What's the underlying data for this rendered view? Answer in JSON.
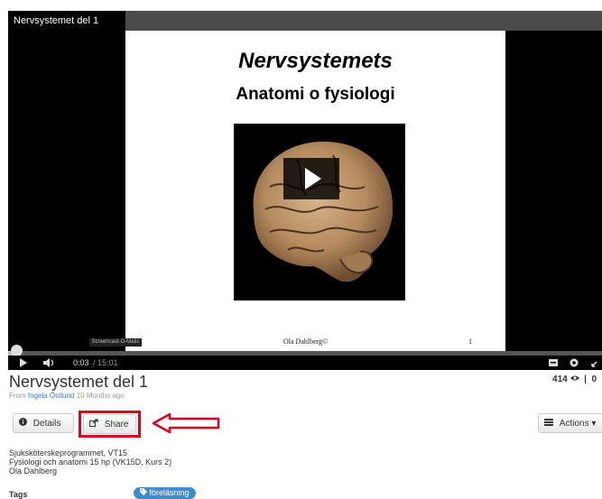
{
  "player": {
    "title": "Nervsystemet del 1",
    "slide_title": "Nervsystemets",
    "slide_subtitle": "Anatomi o fysiologi",
    "slide_author": "Ola Dahlberg©",
    "slide_page": "1",
    "watermark": "Screencast-O-Matic",
    "current_time": "0:03",
    "duration": "/ 15:01",
    "progress_fraction": 0.01
  },
  "video": {
    "title": "Nervsystemet del 1",
    "views": "414",
    "likes": "0",
    "from_label": "From",
    "author": "Ingela Östlund",
    "age": "10 Months ago"
  },
  "buttons": {
    "details": "Details",
    "share": "Share",
    "actions": "Actions"
  },
  "description": [
    "Sjuksköterskeprogrammet, VT15",
    "Fysiologi och anatomi 15 hp (VK15D, Kurs 2)",
    "Ola Dahlberg"
  ],
  "tags": {
    "label": "Tags",
    "items": [
      "föreläsning"
    ]
  },
  "colors": {
    "highlight": "#e3001b",
    "tag": "#3b8dd0",
    "link": "#3a7bc0"
  }
}
